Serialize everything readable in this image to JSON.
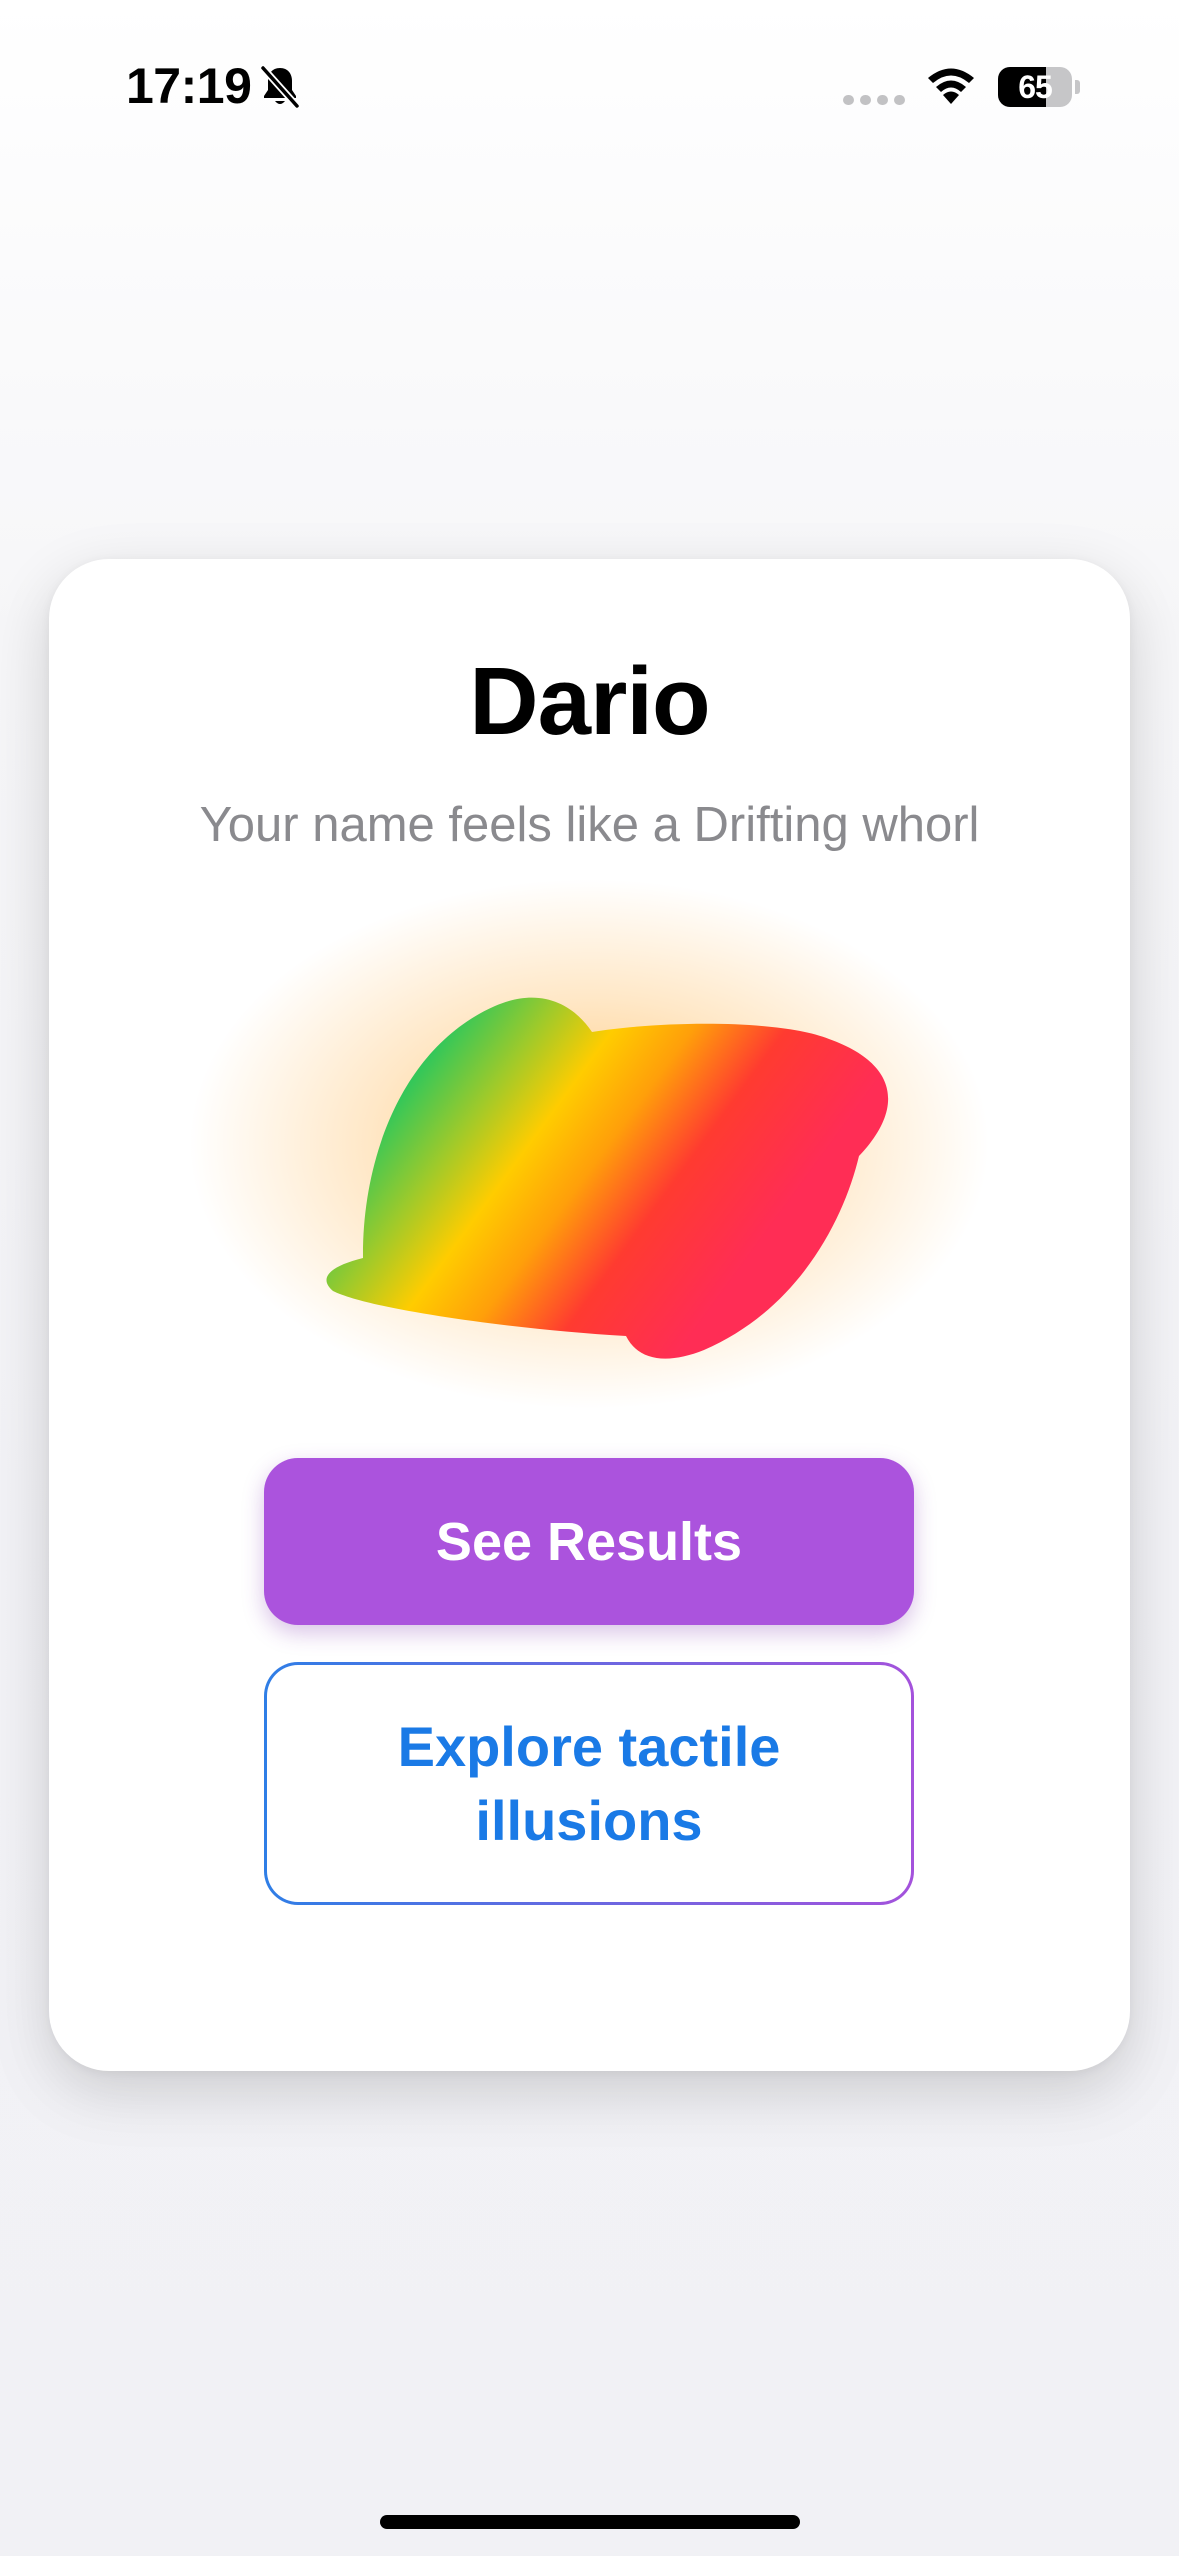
{
  "status_bar": {
    "time": "17:19",
    "battery_percent": "65",
    "battery_level": 0.65,
    "icons": [
      "bell-slash-icon",
      "cellular-signal-icon",
      "wifi-icon",
      "battery-icon"
    ]
  },
  "card": {
    "name": "Dario",
    "subtitle": "Your name feels like a Drifting whorl",
    "blob_colors": [
      "#34c759",
      "#ffcc00",
      "#ff9f0a",
      "#ff3b30",
      "#ff2d55"
    ],
    "blob_glow_color": "#ff9500"
  },
  "actions": {
    "see_results_label": "See Results",
    "explore_label": "Explore tactile illusions"
  },
  "colors": {
    "primary_button": "#ab53dd",
    "secondary_text": "#1a7ae6",
    "secondary_border_start": "#2f7ee6",
    "secondary_border_end": "#a452dc",
    "subtitle_text": "#8a8a8e"
  }
}
